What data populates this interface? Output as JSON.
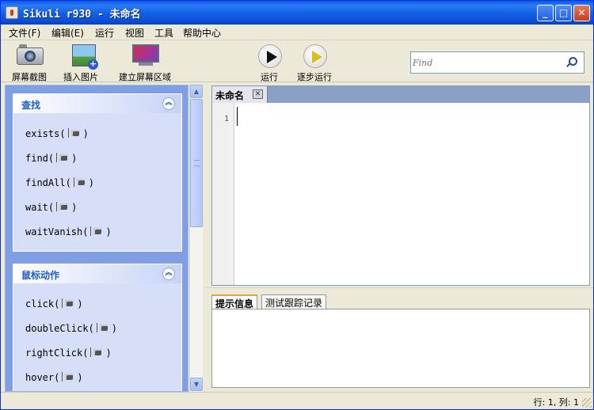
{
  "window": {
    "title": "Sikuli r930 - 未命名",
    "buttons": {
      "minimize": "_",
      "maximize": "□",
      "close": "✕"
    }
  },
  "menu": {
    "items": [
      "文件(F)",
      "编辑(E)",
      "运行",
      "视图",
      "工具",
      "帮助中心"
    ]
  },
  "toolbar": {
    "capture_label": "屏幕截图",
    "insert_image_label": "插入图片",
    "create_region_label": "建立屏幕区域",
    "run_label": "运行",
    "step_run_label": "逐步运行",
    "search_placeholder": "Find"
  },
  "panel": {
    "groups": [
      {
        "title": "查找",
        "commands": [
          "exists(",
          "find(",
          "findAll(",
          "wait(",
          "waitVanish("
        ]
      },
      {
        "title": "鼠标动作",
        "commands": [
          "click(",
          "doubleClick(",
          "rightClick(",
          "hover("
        ]
      }
    ],
    "close_paren": ")",
    "collapse_glyph": "︽"
  },
  "editor": {
    "tab_label": "未命名",
    "tab_close": "✕",
    "line_number": "1"
  },
  "output": {
    "tabs": [
      "提示信息",
      "测试跟踪记录"
    ]
  },
  "status": {
    "text": "行: 1,  列: 1"
  },
  "scrollbar": {
    "up": "▲",
    "down": "▼"
  },
  "colors": {
    "titlebar": "#0a5ae9",
    "panel_bg": "#7f9ee4",
    "group_title": "#215dc6"
  }
}
